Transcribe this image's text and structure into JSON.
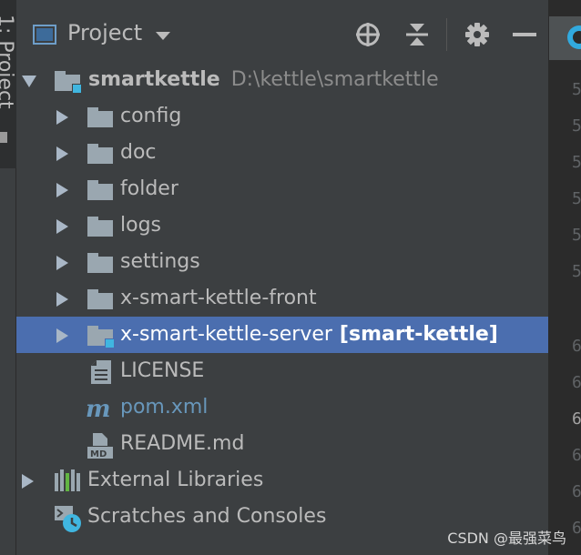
{
  "tool_strip": {
    "label": "1: Project"
  },
  "header": {
    "title": "Project",
    "icons": [
      "project-view-icon",
      "caret-down-icon",
      "locate-icon",
      "collapse-all-icon",
      "gear-icon",
      "minimize-icon"
    ]
  },
  "editor": {
    "line_numbers": [
      "5",
      "5",
      "5",
      "5",
      "5",
      "5",
      "6",
      "6",
      "6",
      "6",
      "6",
      "6"
    ]
  },
  "tree": {
    "root": {
      "name": "smartkettle",
      "path": "D:\\kettle\\smartkettle"
    },
    "folders": [
      "config",
      "doc",
      "folder",
      "logs",
      "settings",
      "x-smart-kettle-front"
    ],
    "module": {
      "name": "x-smart-kettle-server",
      "tag": "[smart-kettle]"
    },
    "files": [
      "LICENSE",
      "pom.xml",
      "README.md"
    ],
    "external_libraries": "External Libraries",
    "scratches": "Scratches and Consoles"
  },
  "colors": {
    "background": "#3c3f41",
    "selection": "#4b6eaf",
    "folder": "#9aa7b0",
    "module_badge": "#40b6e0",
    "maven_blue": "#6897bb"
  },
  "watermark": "CSDN @最强菜鸟"
}
